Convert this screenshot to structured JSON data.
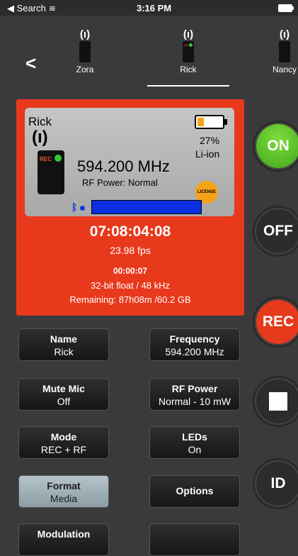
{
  "status": {
    "back": "◀ Search",
    "time": "3:16 PM"
  },
  "transmitters": [
    {
      "name": "Zora"
    },
    {
      "name": "Rick"
    },
    {
      "name": "Nancy"
    }
  ],
  "lcd": {
    "name": "Rick",
    "frequency": "594.200 MHz",
    "rf_power": "RF Power: Normal",
    "battery_percent": "27%",
    "battery_level": 0.27,
    "battery_type": "Li-ion",
    "license": "LICENSE",
    "rec_tag": "REC",
    "bt_icon": "bluetooth-icon"
  },
  "panel": {
    "timecode": "07:08:04:08",
    "fps": "23.98 fps",
    "duration": "00:00:07",
    "format": "32-bit float / 48 kHz",
    "remaining": "Remaining: 87h08m /60.2 GB"
  },
  "side_buttons": {
    "on": "ON",
    "off": "OFF",
    "rec": "REC",
    "id": "ID"
  },
  "grid": {
    "name": {
      "title": "Name",
      "value": "Rick"
    },
    "frequency": {
      "title": "Frequency",
      "value": "594.200 MHz"
    },
    "mute": {
      "title": "Mute Mic",
      "value": "Off"
    },
    "rfpower": {
      "title": "RF Power",
      "value": "Normal - 10 mW"
    },
    "mode": {
      "title": "Mode",
      "value": "REC + RF"
    },
    "leds": {
      "title": "LEDs",
      "value": "On"
    },
    "format": {
      "title": "Format",
      "value": "Media"
    },
    "options": {
      "title": "Options"
    },
    "modulation": {
      "title": "Modulation"
    }
  },
  "colors": {
    "panel": "#e8391c",
    "on": "#3ea51a",
    "rec": "#e53a1c",
    "meter": "#0a2ee0"
  }
}
